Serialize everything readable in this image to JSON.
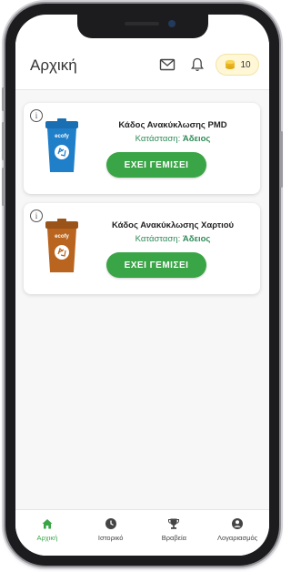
{
  "header": {
    "title": "Αρχική",
    "coins": "10",
    "icons": [
      "mail-icon",
      "bell-icon",
      "coin-stack-icon"
    ]
  },
  "bins": [
    {
      "title": "Κάδος Ανακύκλωσης PMD",
      "status_label": "Κατάσταση:",
      "status_value": "Άδειος",
      "button_label": "ΕΧΕΙ ΓΕΜΙΣΕΙ",
      "bin_label": "ecofy",
      "bin_color": "#1f7fc9"
    },
    {
      "title": "Κάδος Ανακύκλωσης Χαρτιού",
      "status_label": "Κατάσταση:",
      "status_value": "Άδειος",
      "button_label": "ΕΧΕΙ ΓΕΜΙΣΕΙ",
      "bin_label": "ecofy",
      "bin_color": "#b9651f"
    }
  ],
  "nav": [
    {
      "label": "Αρχική",
      "icon": "home-icon",
      "active": true
    },
    {
      "label": "Ιστορικό",
      "icon": "clock-icon",
      "active": false
    },
    {
      "label": "Βραβεία",
      "icon": "trophy-icon",
      "active": false
    },
    {
      "label": "Λογαριασμός",
      "icon": "account-icon",
      "active": false
    }
  ],
  "colors": {
    "accent": "#3aa546",
    "status_text": "#2e8b57",
    "pmd_bin": "#1f7fc9",
    "paper_bin": "#b9651f",
    "coin": "#f2c230"
  }
}
